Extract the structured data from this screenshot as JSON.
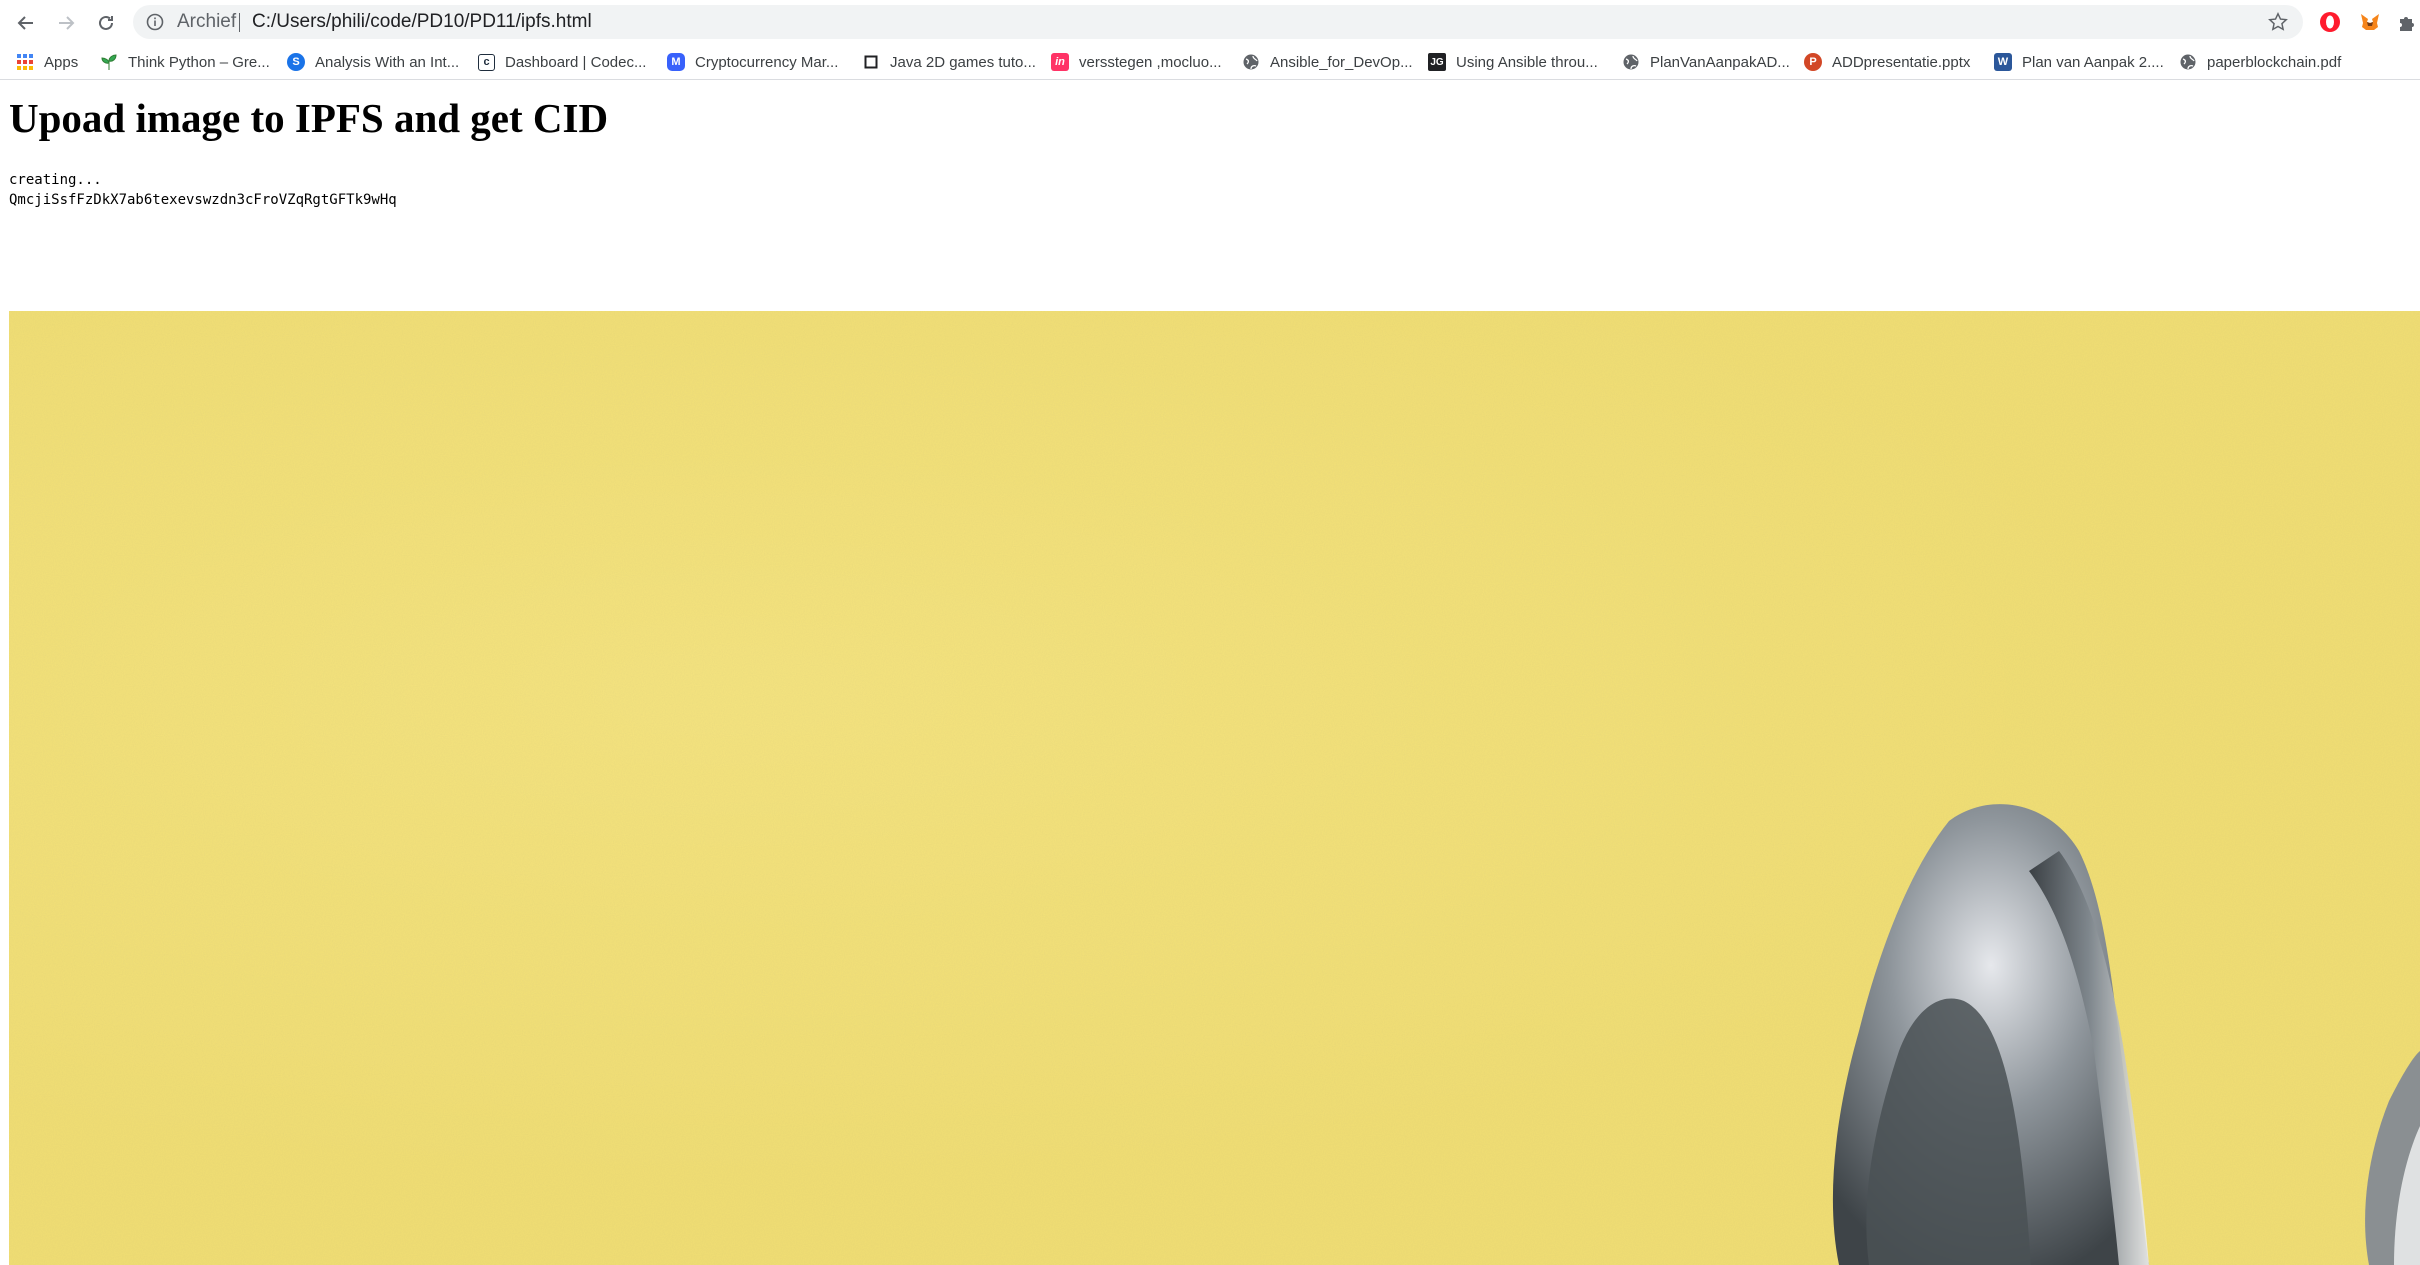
{
  "browser": {
    "omnibox": {
      "scheme_label": "Archief",
      "url": "C:/Users/phili/code/PD10/PD11/ipfs.html"
    },
    "bookmarks": [
      {
        "label": "Apps",
        "icon": "apps-grid-icon",
        "color": "#4285f4"
      },
      {
        "label": "Think Python – Gre...",
        "icon": "leaf-icon",
        "color": "#34a853"
      },
      {
        "label": "Analysis With an Int...",
        "icon": "globe-icon",
        "color": "#1a73e8"
      },
      {
        "label": "Dashboard | Codec...",
        "icon": "codecademy-icon",
        "color": "#1f2d3d"
      },
      {
        "label": "Cryptocurrency Mar...",
        "icon": "coinmarketcap-icon",
        "color": "#3861fb"
      },
      {
        "label": "Java 2D games tuto...",
        "icon": "square-icon",
        "color": "#202124"
      },
      {
        "label": "versstegen ,mocluo...",
        "icon": "invision-icon",
        "color": "#ff3366"
      },
      {
        "label": "Ansible_for_DevOp...",
        "icon": "globe-icon",
        "color": "#5f6368"
      },
      {
        "label": "Using Ansible throu...",
        "icon": "jg-icon",
        "color": "#202124"
      },
      {
        "label": "PlanVanAanpakAD...",
        "icon": "globe-icon",
        "color": "#5f6368"
      },
      {
        "label": "ADDpresentatie.pptx",
        "icon": "powerpoint-icon",
        "color": "#d24726"
      },
      {
        "label": "Plan van Aanpak 2....",
        "icon": "word-icon",
        "color": "#2b579a"
      },
      {
        "label": "paperblockchain.pdf",
        "icon": "globe-icon",
        "color": "#5f6368"
      }
    ]
  },
  "page": {
    "title": "Upoad image to IPFS and get CID",
    "status_text": "creating...",
    "cid": "QmcjiSsfFzDkX7ab6texevswzdn3cFroVZqRgtGFTk9wHq"
  },
  "image": {
    "description_icon": "uploaded-photo-icon",
    "background_color": "#f2df72"
  }
}
